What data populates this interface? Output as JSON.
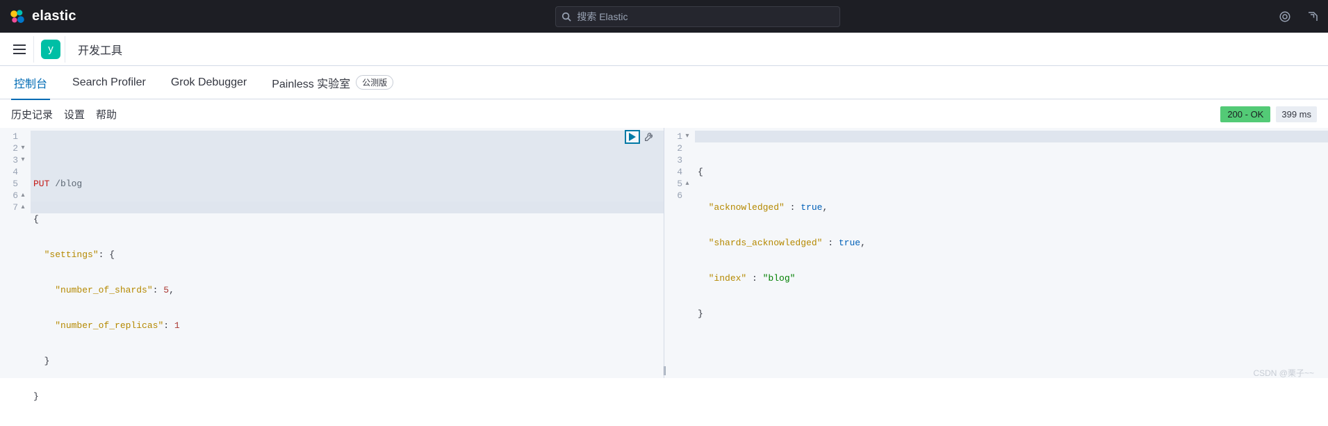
{
  "header": {
    "brand": "elastic",
    "search_placeholder": "搜索 Elastic"
  },
  "appbar": {
    "space_initial": "y",
    "breadcrumb": "开发工具"
  },
  "tabs": {
    "console": "控制台",
    "profiler": "Search Profiler",
    "grok": "Grok Debugger",
    "painless": "Painless 实验室",
    "beta_label": "公测版"
  },
  "toolbar": {
    "history": "历史记录",
    "settings": "设置",
    "help": "帮助"
  },
  "status": {
    "badge": "200 - OK",
    "time": "399 ms"
  },
  "request": {
    "method": "PUT",
    "path": "/blog",
    "lines": [
      {
        "no": 1,
        "fold": ""
      },
      {
        "no": 2,
        "fold": "▾"
      },
      {
        "no": 3,
        "fold": "▾"
      },
      {
        "no": 4,
        "fold": ""
      },
      {
        "no": 5,
        "fold": ""
      },
      {
        "no": 6,
        "fold": "▴"
      },
      {
        "no": 7,
        "fold": "▴"
      }
    ],
    "body": {
      "settings_key": "\"settings\"",
      "shards_key": "\"number_of_shards\"",
      "shards_val": "5",
      "replicas_key": "\"number_of_replicas\"",
      "replicas_val": "1"
    }
  },
  "response": {
    "lines": [
      {
        "no": 1,
        "fold": "▾"
      },
      {
        "no": 2,
        "fold": ""
      },
      {
        "no": 3,
        "fold": ""
      },
      {
        "no": 4,
        "fold": ""
      },
      {
        "no": 5,
        "fold": "▴"
      },
      {
        "no": 6,
        "fold": ""
      }
    ],
    "ack_key": "\"acknowledged\"",
    "ack_val": "true",
    "shack_key": "\"shards_acknowledged\"",
    "shack_val": "true",
    "index_key": "\"index\"",
    "index_val": "\"blog\""
  },
  "watermark": "CSDN @栗子~~"
}
